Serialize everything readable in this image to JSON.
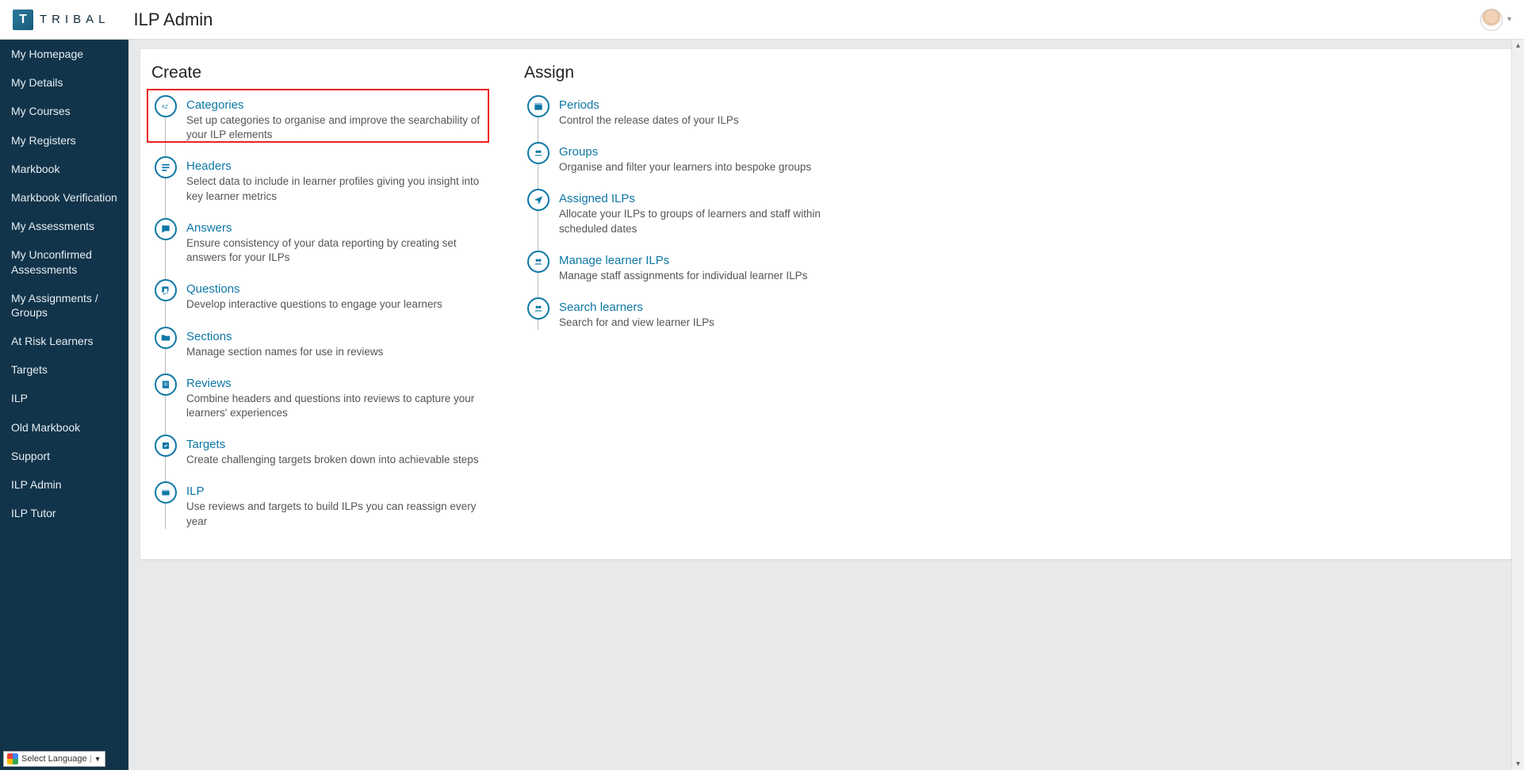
{
  "header": {
    "brand_letter": "T",
    "brand_text": "TRIBAL",
    "page_title": "ILP Admin"
  },
  "sidebar": {
    "items": [
      "My Homepage",
      "My Details",
      "My Courses",
      "My Registers",
      "Markbook",
      "Markbook Verification",
      "My Assessments",
      "My Unconfirmed Assessments",
      "My Assignments / Groups",
      "At Risk Learners",
      "Targets",
      "ILP",
      "Old Markbook",
      "Support",
      "ILP Admin",
      "ILP Tutor"
    ],
    "lang_label": "Select Language"
  },
  "main": {
    "create_title": "Create",
    "assign_title": "Assign",
    "create_items": [
      {
        "icon": "az",
        "title": "Categories",
        "desc": "Set up categories to organise and improve the searchability of your ILP elements"
      },
      {
        "icon": "headers",
        "title": "Headers",
        "desc": "Select data to include in learner profiles giving you insight into key learner metrics"
      },
      {
        "icon": "answers",
        "title": "Answers",
        "desc": "Ensure consistency of your data reporting by creating set answers for your ILPs"
      },
      {
        "icon": "questions",
        "title": "Questions",
        "desc": "Develop interactive questions to engage your learners"
      },
      {
        "icon": "folder",
        "title": "Sections",
        "desc": "Manage section names for use in reviews"
      },
      {
        "icon": "reviews",
        "title": "Reviews",
        "desc": "Combine headers and questions into reviews to capture your learners' experiences"
      },
      {
        "icon": "target",
        "title": "Targets",
        "desc": "Create challenging targets broken down into achievable steps"
      },
      {
        "icon": "ilp",
        "title": "ILP",
        "desc": "Use reviews and targets to build ILPs you can reassign every year"
      }
    ],
    "assign_items": [
      {
        "icon": "calendar",
        "title": "Periods",
        "desc": "Control the release dates of your ILPs"
      },
      {
        "icon": "group",
        "title": "Groups",
        "desc": "Organise and filter your learners into bespoke groups"
      },
      {
        "icon": "send",
        "title": "Assigned ILPs",
        "desc": "Allocate your ILPs to groups of learners and staff within scheduled dates"
      },
      {
        "icon": "group",
        "title": "Manage learner ILPs",
        "desc": "Manage staff assignments for individual learner ILPs"
      },
      {
        "icon": "group",
        "title": "Search learners",
        "desc": "Search for and view learner ILPs"
      }
    ]
  }
}
